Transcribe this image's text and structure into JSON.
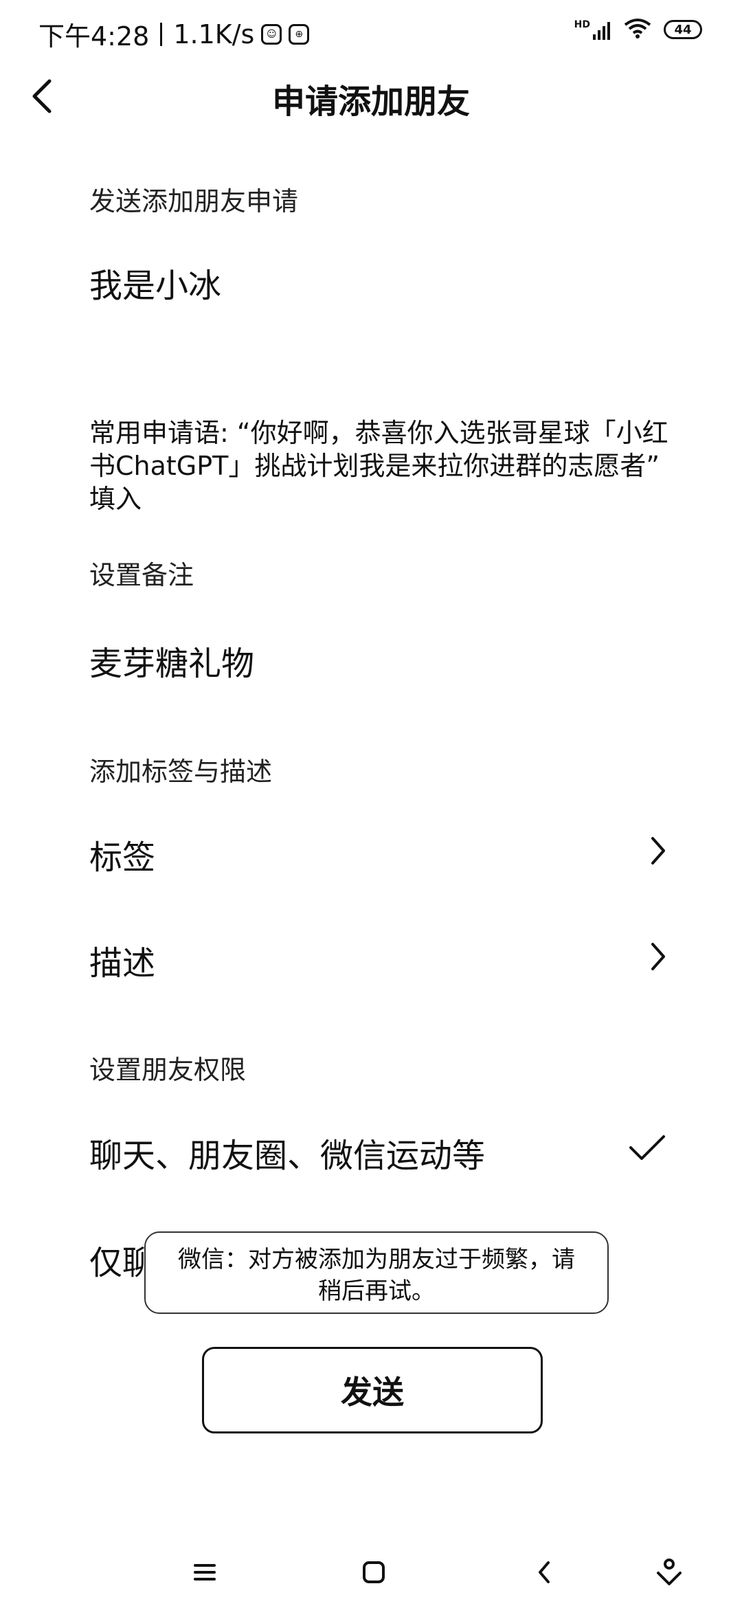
{
  "status_bar": {
    "time": "下午4:28",
    "net_speed": "1.1K/s",
    "signal_label": "HD",
    "battery_level": "44"
  },
  "header": {
    "title": "申请添加朋友"
  },
  "request": {
    "section_label": "发送添加朋友申请",
    "message": "我是小冰",
    "common_phrase_hint": "常用申请语: “你好啊，恭喜你入选张哥星球「小红书ChatGPT」挑战计划我是来拉你进群的志愿者” 填入"
  },
  "remark": {
    "section_label": "设置备注",
    "value": "麦芽糖礼物"
  },
  "tags_desc": {
    "section_label": "添加标签与描述",
    "tags_label": "标签",
    "desc_label": "描述"
  },
  "permissions": {
    "section_label": "设置朋友权限",
    "option_all": "聊天、朋友圈、微信运动等",
    "option_chat_only_partial": "仅聊"
  },
  "toast": {
    "message": "微信：对方被添加为朋友过于频繁，请稍后再试。"
  },
  "actions": {
    "send_label": "发送"
  }
}
